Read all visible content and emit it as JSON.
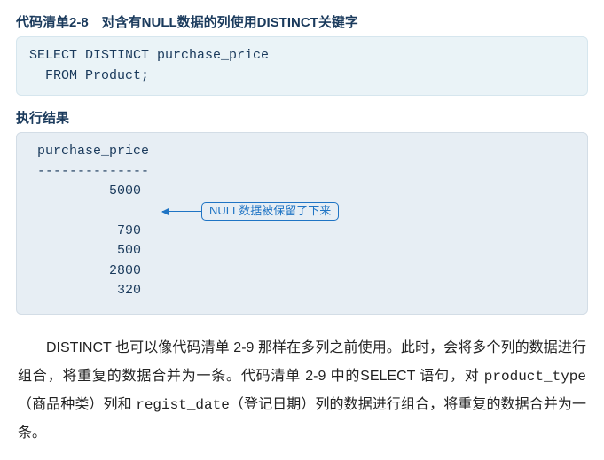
{
  "listing": {
    "title": "代码清单2-8　对含有NULL数据的列使用DISTINCT关键字",
    "code_line1": "SELECT DISTINCT purchase_price",
    "code_line2": "  FROM Product;"
  },
  "result": {
    "title": "执行结果",
    "header": " purchase_price",
    "divider": " --------------",
    "rows_before": [
      "          5000"
    ],
    "annotation_text": "NULL数据被保留了下来",
    "rows_after": [
      "           790",
      "           500",
      "          2800",
      "           320"
    ]
  },
  "body": {
    "p1_seg1": "DISTINCT 也可以像代码清单 2-9 那样在多列之前使用。此时，会将多个列的数据进行组合，将重复的数据合并为一条。代码清单 2-9 中的SELECT 语句，对 ",
    "p1_mono1": "product_type",
    "p1_seg2": "（商品种类）列和 ",
    "p1_mono2": "regist_date",
    "p1_seg3": "（登记日期）列的数据进行组合，将重复的数据合并为一条。"
  }
}
